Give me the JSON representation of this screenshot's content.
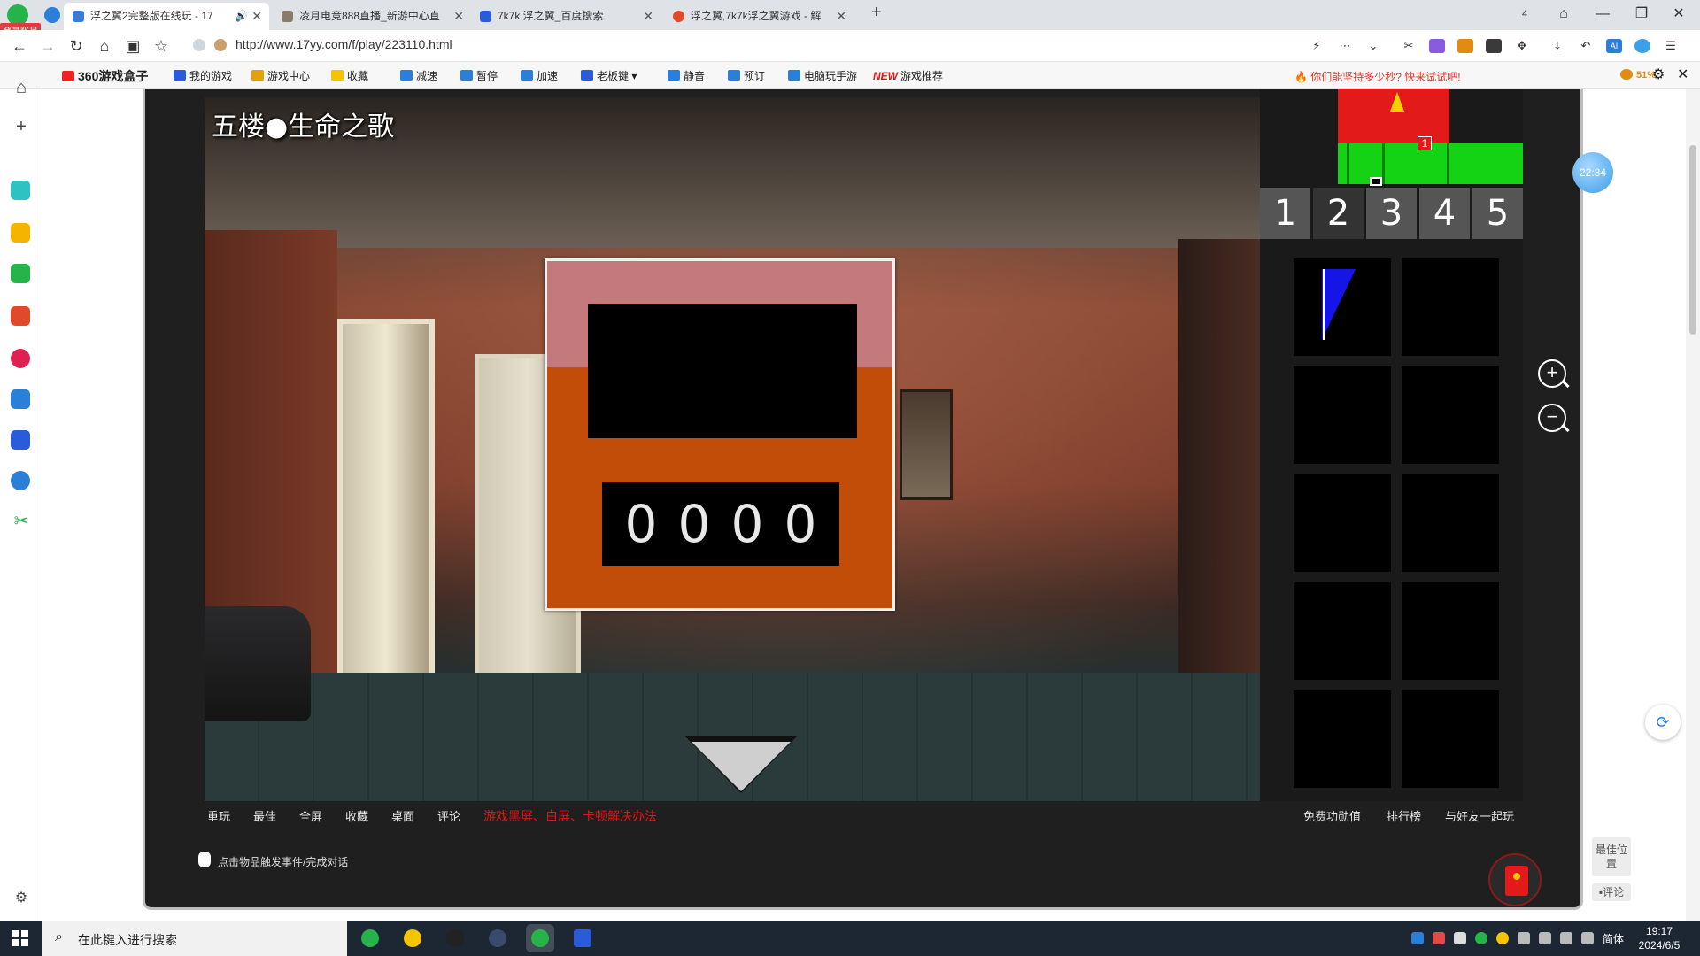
{
  "browser": {
    "login_badge": "登录账号",
    "tabs": [
      {
        "title": "浮之翼2完整版在线玩 - 17",
        "active": true
      },
      {
        "title": "凌月电竞888直播_新游中心直"
      },
      {
        "title": "7k7k 浮之翼_百度搜索"
      },
      {
        "title": "浮之翼,7k7k浮之翼游戏 - 解"
      }
    ],
    "tab_count_badge": "4",
    "url": "http://www.17yy.com/f/play/223110.html"
  },
  "gamebar": {
    "title": "360游戏盒子",
    "items": [
      "我的游戏",
      "游戏中心",
      "收藏",
      "减速",
      "暂停",
      "加速",
      "老板键",
      "静音",
      "预订",
      "电脑玩手游",
      "游戏推荐"
    ],
    "new_tag": "NEW",
    "promo": "你们能坚持多少秒? 快来试试吧!",
    "percent": "51%"
  },
  "game": {
    "scene_title": "五楼●生命之歌",
    "lock_code": [
      "0",
      "0",
      "0",
      "0"
    ],
    "map_marker": "1",
    "floors": [
      "1",
      "2",
      "3",
      "4",
      "5"
    ],
    "active_floor": 2,
    "inventory_slots": 10
  },
  "game_links": {
    "left": [
      "重玩",
      "最佳",
      "全屏",
      "收藏",
      "桌面",
      "评论"
    ],
    "warning": "游戏黑屏、白屏、卡顿解决办法",
    "right": [
      "免费功勋值",
      "排行榜",
      "与好友一起玩"
    ],
    "hint": "点击物品触发事件/完成对话"
  },
  "widgets": {
    "timer": "22:34",
    "best_position": "最佳位置",
    "comment": "评论"
  },
  "taskbar": {
    "search_placeholder": "在此键入进行搜索",
    "ime": "简体",
    "time": "19:17",
    "date": "2024/6/5"
  },
  "colors": {
    "lock_body": "#c24d09",
    "lock_top": "#c47a7c",
    "map_red": "#e21a1a",
    "map_green": "#14d314",
    "inventory_item": "#1515e8",
    "warning_text": "#e01515"
  }
}
